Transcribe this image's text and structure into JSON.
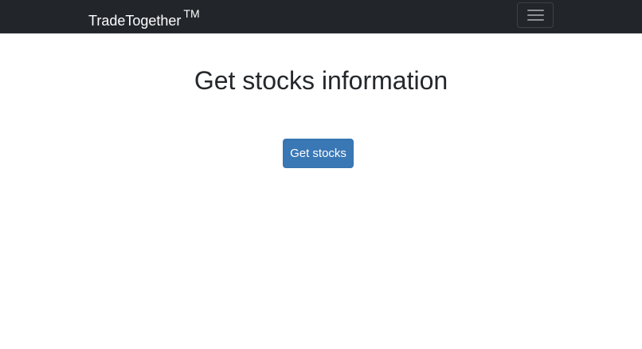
{
  "navbar": {
    "brand_name": "TradeTogether",
    "brand_mark": "TM",
    "toggler_icon": "hamburger-menu-icon"
  },
  "main": {
    "title": "Get stocks information",
    "get_stocks_label": "Get stocks"
  },
  "colors": {
    "navbar_bg": "#22262b",
    "primary_button": "#3a77b5",
    "text": "#24282c"
  }
}
